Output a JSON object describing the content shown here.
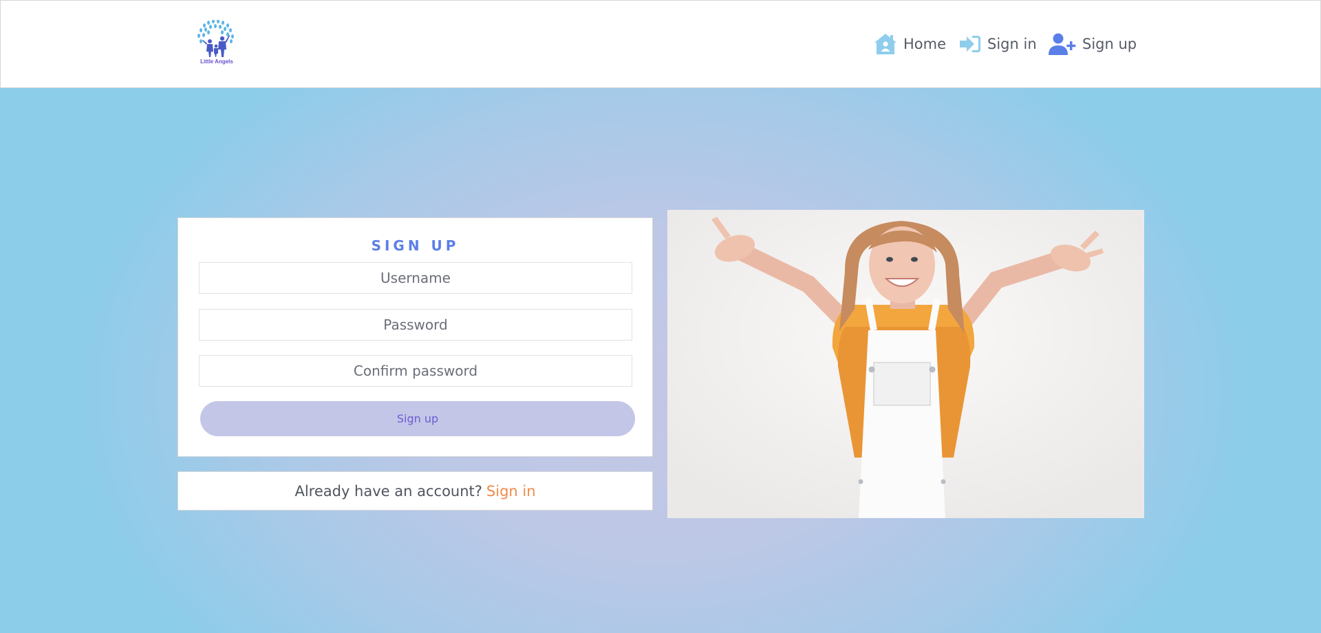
{
  "brand": {
    "logo_text": "Little Angels",
    "accent_color": "#5b7fe8",
    "link_color": "#f08a4b",
    "button_color": "#c3c6e6"
  },
  "nav": {
    "home_label": "Home",
    "home_icon": "home-icon",
    "signin_label": "Sign in",
    "signin_icon": "sign-in-icon",
    "signup_label": "Sign up",
    "signup_icon": "user-plus-icon"
  },
  "form": {
    "title": "SIGN UP",
    "username_placeholder": "Username",
    "password_placeholder": "Password",
    "confirm_placeholder": "Confirm password",
    "submit_label": "Sign up"
  },
  "signin_prompt": {
    "text": "Already have an account?",
    "link_label": "Sign in"
  }
}
